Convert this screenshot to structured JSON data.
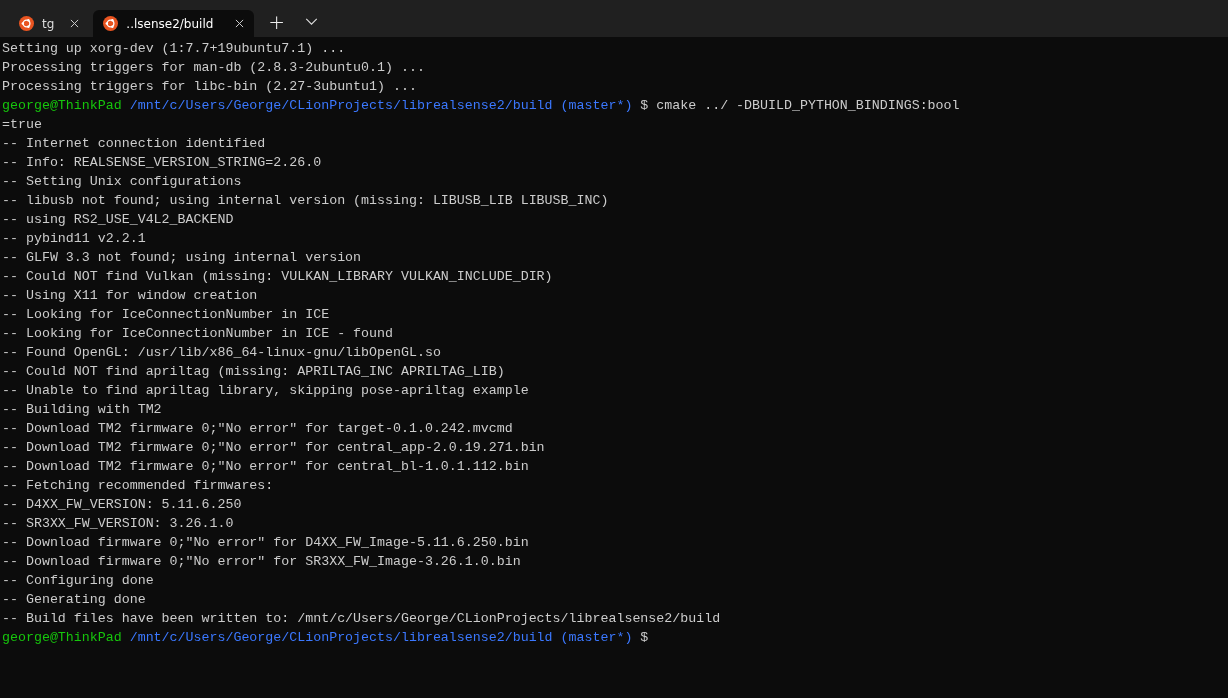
{
  "tabs": [
    {
      "title": "tg",
      "selected": false
    },
    {
      "title": "..lsense2/build",
      "selected": true
    }
  ],
  "new_tab": "+",
  "lines": [
    {
      "kind": "output",
      "text": "Setting up xorg-dev (1:7.7+19ubuntu7.1) ..."
    },
    {
      "kind": "output",
      "text": "Processing triggers for man-db (2.8.3-2ubuntu0.1) ..."
    },
    {
      "kind": "output",
      "text": "Processing triggers for libc-bin (2.27-3ubuntu1) ..."
    },
    {
      "kind": "prompt",
      "user": "george@ThinkPad",
      "path": "/mnt/c/Users/George/CLionProjects/librealsense2/build",
      "branch": "(master*)",
      "symbol": "$",
      "command": "cmake ../ -DBUILD_PYTHON_BINDINGS:bool"
    },
    {
      "kind": "output",
      "text": "=true"
    },
    {
      "kind": "output",
      "text": "-- Internet connection identified"
    },
    {
      "kind": "output",
      "text": "-- Info: REALSENSE_VERSION_STRING=2.26.0"
    },
    {
      "kind": "output",
      "text": "-- Setting Unix configurations"
    },
    {
      "kind": "output",
      "text": "-- libusb not found; using internal version (missing: LIBUSB_LIB LIBUSB_INC)"
    },
    {
      "kind": "output",
      "text": "-- using RS2_USE_V4L2_BACKEND"
    },
    {
      "kind": "output",
      "text": "-- pybind11 v2.2.1"
    },
    {
      "kind": "output",
      "text": "-- GLFW 3.3 not found; using internal version"
    },
    {
      "kind": "output",
      "text": "-- Could NOT find Vulkan (missing: VULKAN_LIBRARY VULKAN_INCLUDE_DIR)"
    },
    {
      "kind": "output",
      "text": "-- Using X11 for window creation"
    },
    {
      "kind": "output",
      "text": "-- Looking for IceConnectionNumber in ICE"
    },
    {
      "kind": "output",
      "text": "-- Looking for IceConnectionNumber in ICE - found"
    },
    {
      "kind": "output",
      "text": "-- Found OpenGL: /usr/lib/x86_64-linux-gnu/libOpenGL.so"
    },
    {
      "kind": "output",
      "text": "-- Could NOT find apriltag (missing: APRILTAG_INC APRILTAG_LIB)"
    },
    {
      "kind": "output",
      "text": "-- Unable to find apriltag library, skipping pose-apriltag example"
    },
    {
      "kind": "output",
      "text": "-- Building with TM2"
    },
    {
      "kind": "output",
      "text": "-- Download TM2 firmware 0;\"No error\" for target-0.1.0.242.mvcmd"
    },
    {
      "kind": "output",
      "text": "-- Download TM2 firmware 0;\"No error\" for central_app-2.0.19.271.bin"
    },
    {
      "kind": "output",
      "text": "-- Download TM2 firmware 0;\"No error\" for central_bl-1.0.1.112.bin"
    },
    {
      "kind": "output",
      "text": "-- Fetching recommended firmwares:"
    },
    {
      "kind": "output",
      "text": "-- D4XX_FW_VERSION: 5.11.6.250"
    },
    {
      "kind": "output",
      "text": "-- SR3XX_FW_VERSION: 3.26.1.0"
    },
    {
      "kind": "output",
      "text": "-- Download firmware 0;\"No error\" for D4XX_FW_Image-5.11.6.250.bin"
    },
    {
      "kind": "output",
      "text": "-- Download firmware 0;\"No error\" for SR3XX_FW_Image-3.26.1.0.bin"
    },
    {
      "kind": "output",
      "text": "-- Configuring done"
    },
    {
      "kind": "output",
      "text": "-- Generating done"
    },
    {
      "kind": "output",
      "text": "-- Build files have been written to: /mnt/c/Users/George/CLionProjects/librealsense2/build"
    },
    {
      "kind": "prompt",
      "user": "george@ThinkPad",
      "path": "/mnt/c/Users/George/CLionProjects/librealsense2/build",
      "branch": "(master*)",
      "symbol": "$"
    }
  ]
}
